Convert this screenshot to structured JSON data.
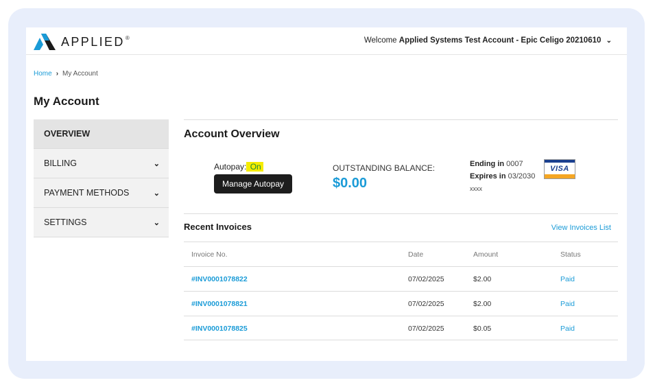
{
  "header": {
    "logo_text": "APPLIED",
    "logo_tm": "®",
    "welcome_prefix": "Welcome",
    "account_name": "Applied Systems Test Account - Epic Celigo 20210610",
    "dropdown_icon": "chevron-down-icon"
  },
  "breadcrumb": {
    "home": "Home",
    "separator_icon": "chevron-right-icon",
    "current": "My Account"
  },
  "page_title": "My Account",
  "sidebar": {
    "items": [
      {
        "label": "OVERVIEW",
        "active": true,
        "has_chevron": false
      },
      {
        "label": "BILLING",
        "active": false,
        "has_chevron": true
      },
      {
        "label": "PAYMENT METHODS",
        "active": false,
        "has_chevron": true
      },
      {
        "label": "SETTINGS",
        "active": false,
        "has_chevron": true
      }
    ]
  },
  "overview": {
    "title": "Account Overview",
    "autopay_label": "Autopay:",
    "autopay_status": " On",
    "manage_autopay": "Manage Autopay",
    "balance_label": "OUTSTANDING BALANCE:",
    "balance_value": "$0.00",
    "card_ending_label": "Ending in",
    "card_ending_value": "0007",
    "card_expires_label": "Expires in",
    "card_expires_value": "03/2030",
    "card_mask": "xxxx",
    "card_brand": "VISA"
  },
  "invoices": {
    "title": "Recent Invoices",
    "view_list": "View Invoices List",
    "columns": [
      "Invoice No.",
      "Date",
      "Amount",
      "Status"
    ],
    "rows": [
      {
        "invoice": "#INV0001078822",
        "date": "07/02/2025",
        "amount": "$2.00",
        "status": "Paid"
      },
      {
        "invoice": "#INV0001078821",
        "date": "07/02/2025",
        "amount": "$2.00",
        "status": "Paid"
      },
      {
        "invoice": "#INV0001078825",
        "date": "07/02/2025",
        "amount": "$0.05",
        "status": "Paid"
      }
    ]
  },
  "colors": {
    "accent": "#1a9bd7",
    "highlight": "#f5ec00",
    "frame": "#e8eefb"
  }
}
